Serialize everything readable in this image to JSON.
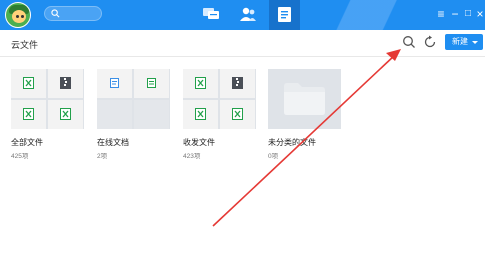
{
  "breadcrumb": "云文件",
  "toolbar": {
    "new_label": "新建",
    "search_icon": "search-icon",
    "refresh_icon": "refresh-icon"
  },
  "folders": [
    {
      "name": "全部文件",
      "count": "425项"
    },
    {
      "name": "在线文档",
      "count": "2项"
    },
    {
      "name": "收发文件",
      "count": "423项"
    },
    {
      "name": "未分类的文件",
      "count": "0项"
    }
  ],
  "window_controls": {
    "menu": "≡",
    "minimize": "−",
    "maximize": "□",
    "close": "×"
  },
  "colors": {
    "accent": "#1f8ef1",
    "arrow": "#e53935",
    "excel": "#22a04b"
  }
}
